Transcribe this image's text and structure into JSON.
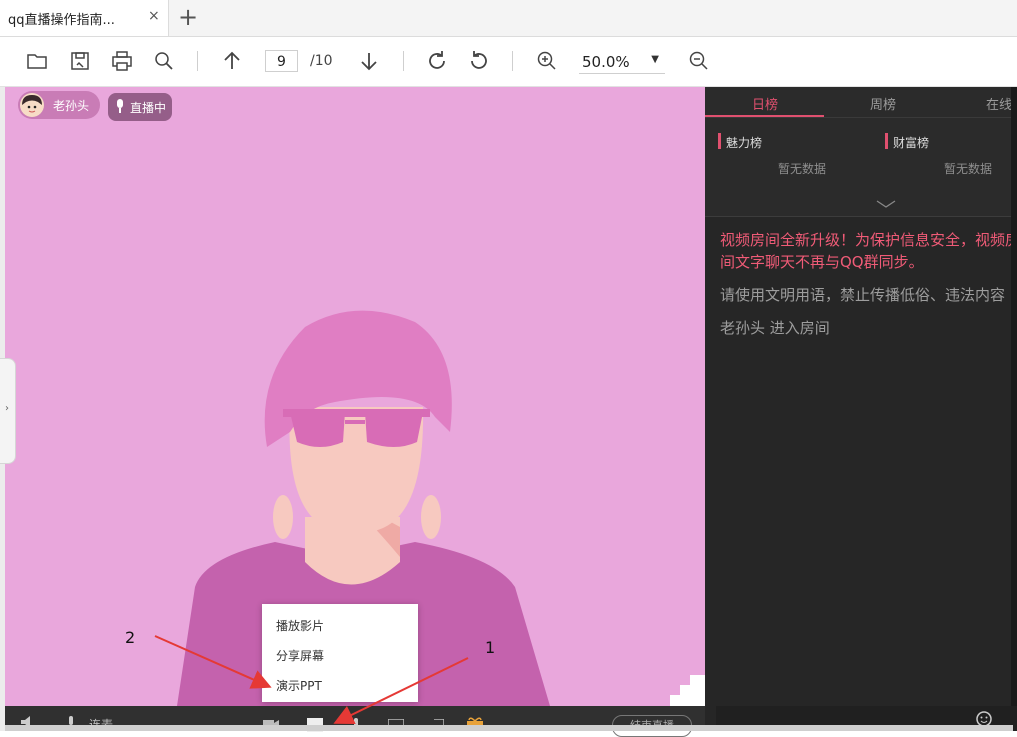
{
  "tab": {
    "title": "qq直播操作指南...",
    "close": "×",
    "new": "+"
  },
  "toolbar": {
    "icons": [
      "open-folder-icon",
      "save-icon",
      "print-icon",
      "search-icon",
      "page-up-icon",
      "page-down-icon",
      "rotate-cw-icon",
      "rotate-ccw-icon",
      "zoom-in-icon",
      "zoom-out-icon"
    ],
    "page_current": "9",
    "page_total": "/10",
    "zoom": "50.0%"
  },
  "stage": {
    "host_name": "老孙头",
    "live_badge": "直播中",
    "bottom_label": "连麦",
    "end_button": "结束直播",
    "popup_items": [
      "播放影片",
      "分享屏幕",
      "演示PPT"
    ],
    "annotation_1": "1",
    "annotation_2": "2"
  },
  "panel": {
    "tabs": [
      "日榜",
      "周榜",
      "在线"
    ],
    "rank_charm": "魅力榜",
    "rank_wealth": "财富榜",
    "empty_text": "暂无数据",
    "notice": "视频房间全新升级！为保护信息安全，视频房间文字聊天不再与QQ群同步。",
    "rule_line": "请使用文明用语，禁止传播低俗、违法内容",
    "enter_line": "老孙头 进入房间"
  },
  "colors": {
    "stage_bg": "#e9a7dc",
    "accent": "#e0506f",
    "panel_bg": "#262626"
  }
}
